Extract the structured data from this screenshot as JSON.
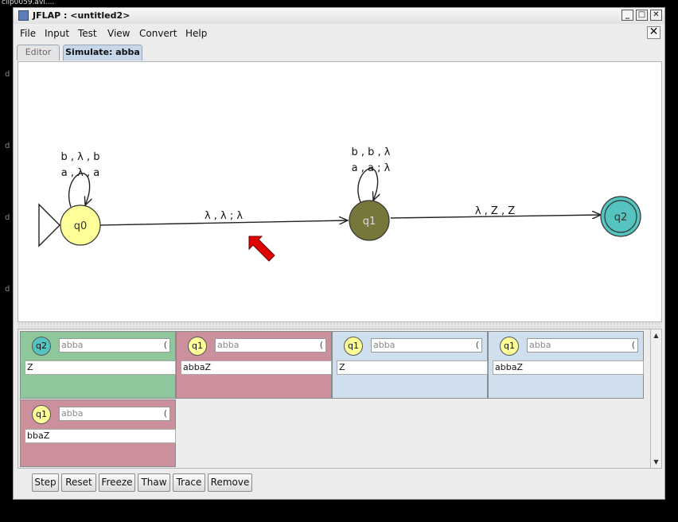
{
  "screen_caption": "clip0059.avi....",
  "margin_marks": [
    "d",
    "d",
    "d",
    "d"
  ],
  "window": {
    "title": "JFLAP : <untitled2>",
    "controls": {
      "minimize": "_",
      "maximize": "□",
      "close": "✕"
    }
  },
  "menu": [
    "File",
    "Input",
    "Test",
    "View",
    "Convert",
    "Help"
  ],
  "doc_close_label": "✕",
  "tabs": {
    "editor": "Editor",
    "simulate": "Simulate: abba"
  },
  "automaton": {
    "states": [
      {
        "id": "q0",
        "label": "q0",
        "initial": true,
        "final": false,
        "color": "#ffff99"
      },
      {
        "id": "q1",
        "label": "q1",
        "initial": false,
        "final": false,
        "color": "#77773c"
      },
      {
        "id": "q2",
        "label": "q2",
        "initial": false,
        "final": true,
        "color": "#55c4c0"
      }
    ],
    "loops": {
      "q0": [
        "b , λ , b",
        "a , λ , a"
      ],
      "q1": [
        "b , b , λ",
        "a , a ; λ"
      ]
    },
    "transitions": [
      {
        "from": "q0",
        "to": "q1",
        "label": "λ , λ ; λ"
      },
      {
        "from": "q1",
        "to": "q2",
        "label": "λ , Z , Z"
      }
    ],
    "cursor_color": "#e00000"
  },
  "configurations": [
    {
      "state": "q2",
      "input": "abba",
      "stack": "Z",
      "status": "accepted",
      "bg": "#8fc79c",
      "circle": "#55c4c0"
    },
    {
      "state": "q1",
      "input": "abba",
      "stack": "abbaZ",
      "status": "rejected",
      "bg": "#cc8f9c",
      "circle": "#ffff99"
    },
    {
      "state": "q1",
      "input": "abba",
      "stack": "Z",
      "status": "normal",
      "bg": "#cfdfee",
      "circle": "#ffff99"
    },
    {
      "state": "q1",
      "input": "abba",
      "stack": "abbaZ",
      "status": "normal",
      "bg": "#cfdfee",
      "circle": "#ffff99"
    },
    {
      "state": "q1",
      "input": "abba",
      "stack": "bbaZ",
      "status": "rejected",
      "bg": "#cc8f9c",
      "circle": "#ffff99"
    }
  ],
  "scrollbar": {
    "up": "▲",
    "down": "▼"
  },
  "toolbar": {
    "step": "Step",
    "reset": "Reset",
    "freeze": "Freeze",
    "thaw": "Thaw",
    "trace": "Trace",
    "remove": "Remove"
  }
}
